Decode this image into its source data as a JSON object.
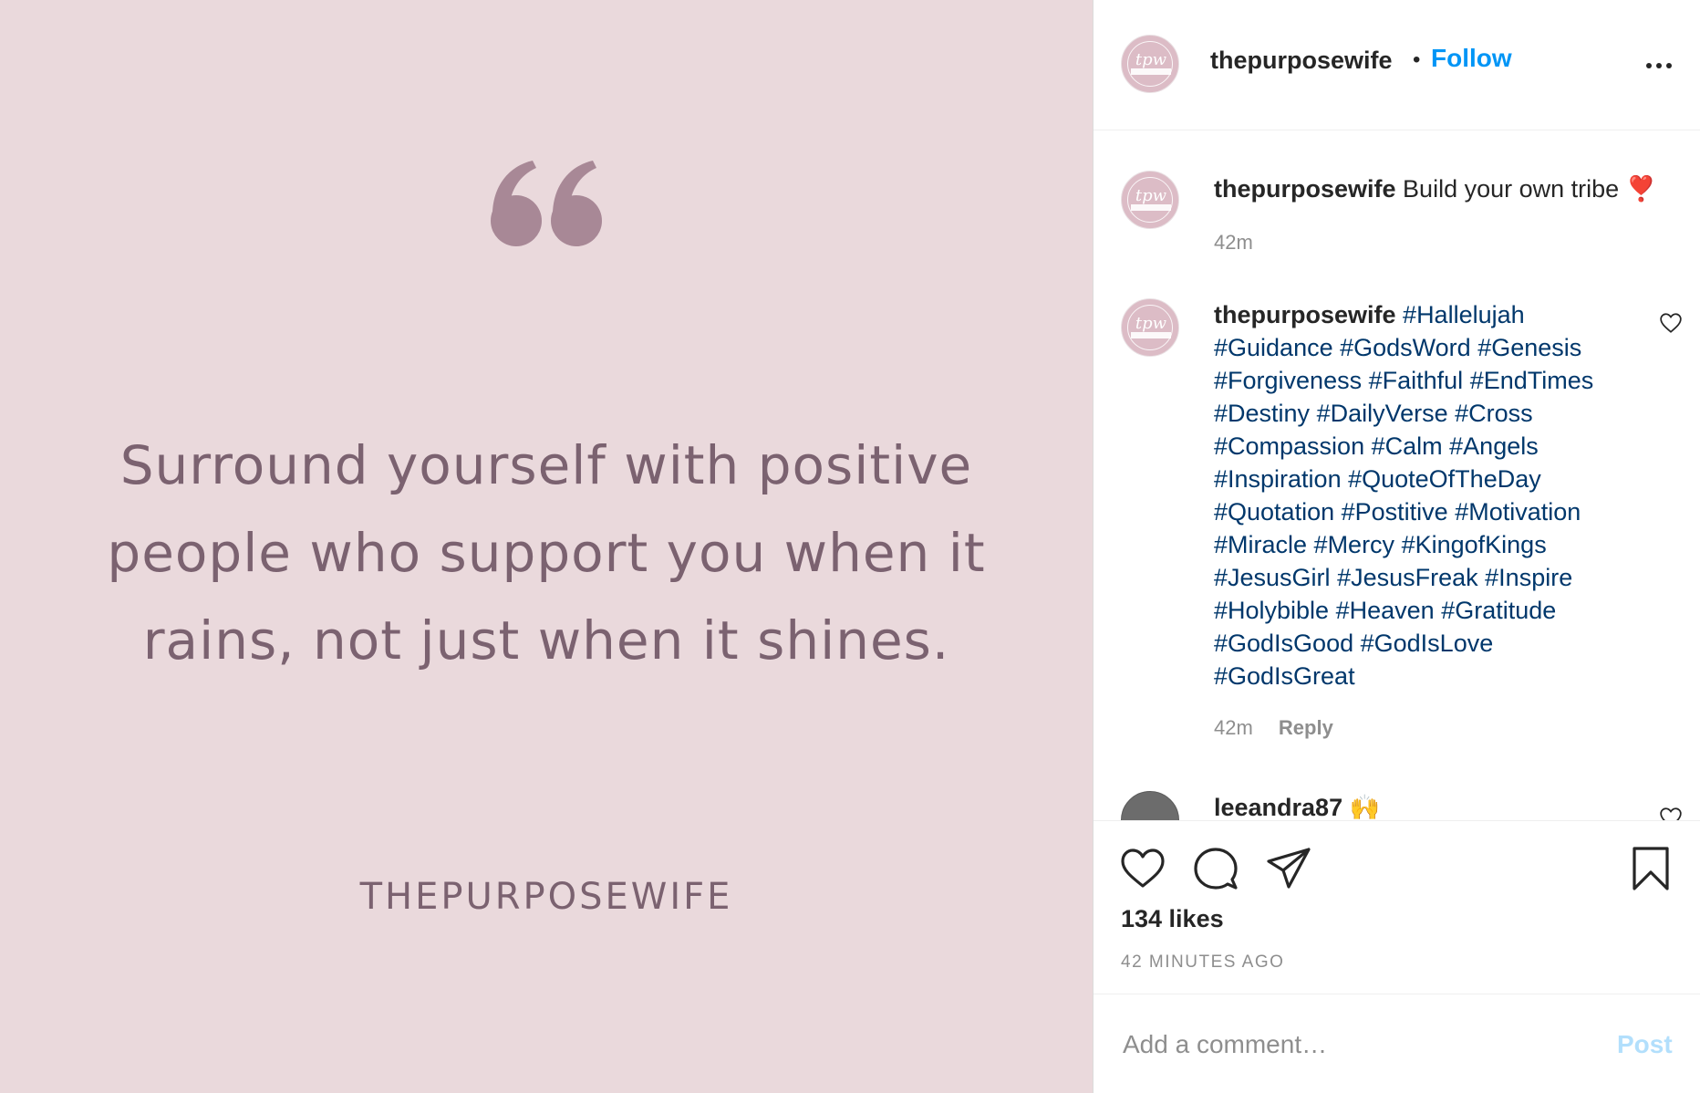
{
  "post": {
    "quote_lines": [
      "Surround yourself with positive",
      "people who support you when it",
      "rains, not just when it shines."
    ],
    "brand_text": "THEPURPOSEWIFE",
    "colors": {
      "image_background": "#ead9dc",
      "quote_color": "#7b6270",
      "quote_mark_color": "#a88896"
    }
  },
  "header": {
    "username": "thepurposewife",
    "separator": "•",
    "follow_label": "Follow",
    "more_icon": "more-horizontal-icon"
  },
  "avatar": {
    "monogram": "tpw"
  },
  "caption": {
    "username": "thepurposewife",
    "text": "Build your own tribe",
    "emoji": "❣️",
    "time": "42m"
  },
  "hashtag_comment": {
    "username": "thepurposewife",
    "lines": [
      [
        "#Hallelujah"
      ],
      [
        "#Guidance",
        "#GodsWord",
        "#Genesis"
      ],
      [
        "#Forgiveness",
        "#Faithful",
        "#EndTimes"
      ],
      [
        "#Destiny",
        "#DailyVerse",
        "#Cross"
      ],
      [
        "#Compassion",
        "#Calm",
        "#Angels"
      ],
      [
        "#Inspiration",
        "#QuoteOfTheDay"
      ],
      [
        "#Quotation",
        "#Postitive",
        "#Motivation"
      ],
      [
        "#Miracle",
        "#Mercy",
        "#KingofKings"
      ],
      [
        "#JesusGirl",
        "#JesusFreak",
        "#Inspire"
      ],
      [
        "#Holybible",
        "#Heaven",
        "#Gratitude"
      ],
      [
        "#GodIsGood",
        "#GodIsLove"
      ],
      [
        "#GodIsGreat"
      ]
    ],
    "time": "42m",
    "reply_label": "Reply"
  },
  "third_comment": {
    "username": "leeandra87",
    "emoji": "🙌"
  },
  "actions": {
    "like_icon": "heart-icon",
    "comment_icon": "comment-icon",
    "share_icon": "share-icon",
    "save_icon": "bookmark-icon",
    "likes": "134 likes",
    "time_ago": "42 MINUTES AGO"
  },
  "add_comment": {
    "placeholder": "Add a comment…",
    "post_label": "Post"
  }
}
